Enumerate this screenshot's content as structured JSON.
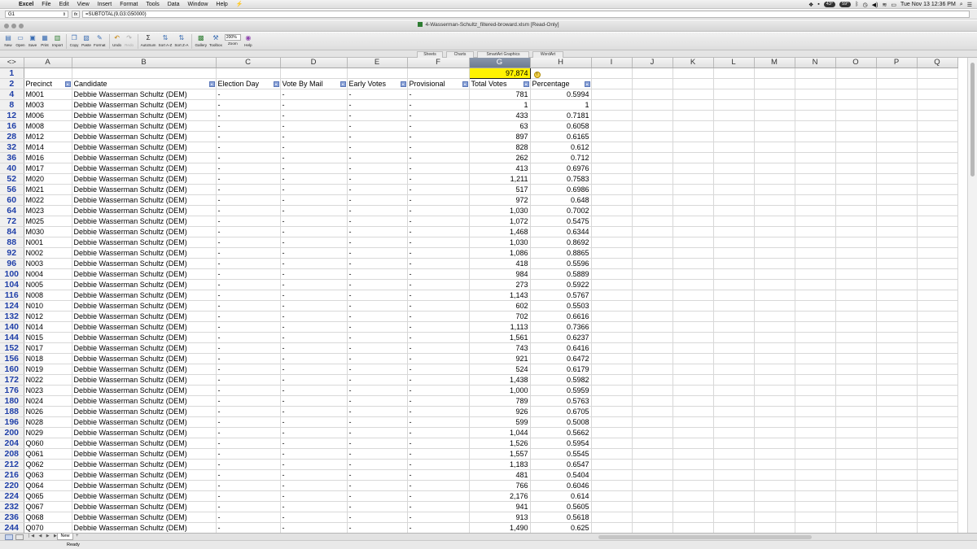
{
  "menubar": {
    "app": "Excel",
    "items": [
      "File",
      "Edit",
      "View",
      "Insert",
      "Format",
      "Tools",
      "Data",
      "Window",
      "Help"
    ],
    "clock": "Tue Nov 13  12:36 PM",
    "badges": [
      "43°",
      "59°"
    ]
  },
  "formula_bar": {
    "cell_ref": "G1",
    "fx": "fx",
    "formula": "=SUBTOTAL(9,G3:G50000)"
  },
  "window": {
    "title": "4-Wasserman-Schultz_filtered-broward.xlsm  [Read-Only]"
  },
  "toolbar": {
    "buttons": [
      {
        "label": "New",
        "icon": "new-document-icon"
      },
      {
        "label": "Open",
        "icon": "open-folder-icon"
      },
      {
        "label": "Save",
        "icon": "save-icon"
      },
      {
        "label": "Print",
        "icon": "print-icon"
      },
      {
        "label": "Import",
        "icon": "import-icon"
      },
      {
        "label": "Copy",
        "icon": "copy-icon"
      },
      {
        "label": "Paste",
        "icon": "paste-icon"
      },
      {
        "label": "Format",
        "icon": "format-brush-icon"
      },
      {
        "label": "Undo",
        "icon": "undo-icon"
      },
      {
        "label": "Redo",
        "icon": "redo-icon"
      },
      {
        "label": "AutoSum",
        "icon": "sigma-icon"
      },
      {
        "label": "Sort A-Z",
        "icon": "sort-az-icon"
      },
      {
        "label": "Sort Z-A",
        "icon": "sort-za-icon"
      },
      {
        "label": "Gallery",
        "icon": "gallery-icon"
      },
      {
        "label": "Toolbox",
        "icon": "toolbox-icon"
      },
      {
        "label": "Zoom",
        "icon": "zoom-icon"
      },
      {
        "label": "Help",
        "icon": "help-icon"
      }
    ],
    "zoom_value": "200%"
  },
  "ribbon_tabs": [
    "Sheets",
    "Charts",
    "SmartArt Graphics",
    "WordArt"
  ],
  "sheet": {
    "columns": [
      "A",
      "B",
      "C",
      "D",
      "E",
      "F",
      "G",
      "H",
      "I",
      "J",
      "K",
      "L",
      "M",
      "N",
      "O",
      "P",
      "Q"
    ],
    "selected_column": "G",
    "total_row_number": "1",
    "total_value": "97,874",
    "header_row_number": "2",
    "headers": [
      "Precinct",
      "Candidate",
      "Election Day",
      "Vote By Mail",
      "Early Votes",
      "Provisional",
      "Total Votes",
      "Percentage"
    ],
    "rows": [
      {
        "n": "4",
        "precinct": "M001",
        "candidate": "Debbie Wasserman Schultz (DEM)",
        "eday": "-",
        "vbm": "-",
        "early": "-",
        "prov": "-",
        "total": "781",
        "pct": "0.5994"
      },
      {
        "n": "8",
        "precinct": "M003",
        "candidate": "Debbie Wasserman Schultz (DEM)",
        "eday": "-",
        "vbm": "-",
        "early": "-",
        "prov": "-",
        "total": "1",
        "pct": "1"
      },
      {
        "n": "12",
        "precinct": "M006",
        "candidate": "Debbie Wasserman Schultz (DEM)",
        "eday": "-",
        "vbm": "-",
        "early": "-",
        "prov": "-",
        "total": "433",
        "pct": "0.7181"
      },
      {
        "n": "16",
        "precinct": "M008",
        "candidate": "Debbie Wasserman Schultz (DEM)",
        "eday": "-",
        "vbm": "-",
        "early": "-",
        "prov": "-",
        "total": "63",
        "pct": "0.6058"
      },
      {
        "n": "28",
        "precinct": "M012",
        "candidate": "Debbie Wasserman Schultz (DEM)",
        "eday": "-",
        "vbm": "-",
        "early": "-",
        "prov": "-",
        "total": "897",
        "pct": "0.6165"
      },
      {
        "n": "32",
        "precinct": "M014",
        "candidate": "Debbie Wasserman Schultz (DEM)",
        "eday": "-",
        "vbm": "-",
        "early": "-",
        "prov": "-",
        "total": "828",
        "pct": "0.612"
      },
      {
        "n": "36",
        "precinct": "M016",
        "candidate": "Debbie Wasserman Schultz (DEM)",
        "eday": "-",
        "vbm": "-",
        "early": "-",
        "prov": "-",
        "total": "262",
        "pct": "0.712"
      },
      {
        "n": "40",
        "precinct": "M017",
        "candidate": "Debbie Wasserman Schultz (DEM)",
        "eday": "-",
        "vbm": "-",
        "early": "-",
        "prov": "-",
        "total": "413",
        "pct": "0.6976"
      },
      {
        "n": "52",
        "precinct": "M020",
        "candidate": "Debbie Wasserman Schultz (DEM)",
        "eday": "-",
        "vbm": "-",
        "early": "-",
        "prov": "-",
        "total": "1,211",
        "pct": "0.7583"
      },
      {
        "n": "56",
        "precinct": "M021",
        "candidate": "Debbie Wasserman Schultz (DEM)",
        "eday": "-",
        "vbm": "-",
        "early": "-",
        "prov": "-",
        "total": "517",
        "pct": "0.6986"
      },
      {
        "n": "60",
        "precinct": "M022",
        "candidate": "Debbie Wasserman Schultz (DEM)",
        "eday": "-",
        "vbm": "-",
        "early": "-",
        "prov": "-",
        "total": "972",
        "pct": "0.648"
      },
      {
        "n": "64",
        "precinct": "M023",
        "candidate": "Debbie Wasserman Schultz (DEM)",
        "eday": "-",
        "vbm": "-",
        "early": "-",
        "prov": "-",
        "total": "1,030",
        "pct": "0.7002"
      },
      {
        "n": "72",
        "precinct": "M025",
        "candidate": "Debbie Wasserman Schultz (DEM)",
        "eday": "-",
        "vbm": "-",
        "early": "-",
        "prov": "-",
        "total": "1,072",
        "pct": "0.5475"
      },
      {
        "n": "84",
        "precinct": "M030",
        "candidate": "Debbie Wasserman Schultz (DEM)",
        "eday": "-",
        "vbm": "-",
        "early": "-",
        "prov": "-",
        "total": "1,468",
        "pct": "0.6344"
      },
      {
        "n": "88",
        "precinct": "N001",
        "candidate": "Debbie Wasserman Schultz (DEM)",
        "eday": "-",
        "vbm": "-",
        "early": "-",
        "prov": "-",
        "total": "1,030",
        "pct": "0.8692"
      },
      {
        "n": "92",
        "precinct": "N002",
        "candidate": "Debbie Wasserman Schultz (DEM)",
        "eday": "-",
        "vbm": "-",
        "early": "-",
        "prov": "-",
        "total": "1,086",
        "pct": "0.8865"
      },
      {
        "n": "96",
        "precinct": "N003",
        "candidate": "Debbie Wasserman Schultz (DEM)",
        "eday": "-",
        "vbm": "-",
        "early": "-",
        "prov": "-",
        "total": "418",
        "pct": "0.5596"
      },
      {
        "n": "100",
        "precinct": "N004",
        "candidate": "Debbie Wasserman Schultz (DEM)",
        "eday": "-",
        "vbm": "-",
        "early": "-",
        "prov": "-",
        "total": "984",
        "pct": "0.5889"
      },
      {
        "n": "104",
        "precinct": "N005",
        "candidate": "Debbie Wasserman Schultz (DEM)",
        "eday": "-",
        "vbm": "-",
        "early": "-",
        "prov": "-",
        "total": "273",
        "pct": "0.5922"
      },
      {
        "n": "116",
        "precinct": "N008",
        "candidate": "Debbie Wasserman Schultz (DEM)",
        "eday": "-",
        "vbm": "-",
        "early": "-",
        "prov": "-",
        "total": "1,143",
        "pct": "0.5767"
      },
      {
        "n": "124",
        "precinct": "N010",
        "candidate": "Debbie Wasserman Schultz (DEM)",
        "eday": "-",
        "vbm": "-",
        "early": "-",
        "prov": "-",
        "total": "602",
        "pct": "0.5503"
      },
      {
        "n": "132",
        "precinct": "N012",
        "candidate": "Debbie Wasserman Schultz (DEM)",
        "eday": "-",
        "vbm": "-",
        "early": "-",
        "prov": "-",
        "total": "702",
        "pct": "0.6616"
      },
      {
        "n": "140",
        "precinct": "N014",
        "candidate": "Debbie Wasserman Schultz (DEM)",
        "eday": "-",
        "vbm": "-",
        "early": "-",
        "prov": "-",
        "total": "1,113",
        "pct": "0.7366"
      },
      {
        "n": "144",
        "precinct": "N015",
        "candidate": "Debbie Wasserman Schultz (DEM)",
        "eday": "-",
        "vbm": "-",
        "early": "-",
        "prov": "-",
        "total": "1,561",
        "pct": "0.6237"
      },
      {
        "n": "152",
        "precinct": "N017",
        "candidate": "Debbie Wasserman Schultz (DEM)",
        "eday": "-",
        "vbm": "-",
        "early": "-",
        "prov": "-",
        "total": "743",
        "pct": "0.6416"
      },
      {
        "n": "156",
        "precinct": "N018",
        "candidate": "Debbie Wasserman Schultz (DEM)",
        "eday": "-",
        "vbm": "-",
        "early": "-",
        "prov": "-",
        "total": "921",
        "pct": "0.6472"
      },
      {
        "n": "160",
        "precinct": "N019",
        "candidate": "Debbie Wasserman Schultz (DEM)",
        "eday": "-",
        "vbm": "-",
        "early": "-",
        "prov": "-",
        "total": "524",
        "pct": "0.6179"
      },
      {
        "n": "172",
        "precinct": "N022",
        "candidate": "Debbie Wasserman Schultz (DEM)",
        "eday": "-",
        "vbm": "-",
        "early": "-",
        "prov": "-",
        "total": "1,438",
        "pct": "0.5982"
      },
      {
        "n": "176",
        "precinct": "N023",
        "candidate": "Debbie Wasserman Schultz (DEM)",
        "eday": "-",
        "vbm": "-",
        "early": "-",
        "prov": "-",
        "total": "1,000",
        "pct": "0.5959"
      },
      {
        "n": "180",
        "precinct": "N024",
        "candidate": "Debbie Wasserman Schultz (DEM)",
        "eday": "-",
        "vbm": "-",
        "early": "-",
        "prov": "-",
        "total": "789",
        "pct": "0.5763"
      },
      {
        "n": "188",
        "precinct": "N026",
        "candidate": "Debbie Wasserman Schultz (DEM)",
        "eday": "-",
        "vbm": "-",
        "early": "-",
        "prov": "-",
        "total": "926",
        "pct": "0.6705"
      },
      {
        "n": "196",
        "precinct": "N028",
        "candidate": "Debbie Wasserman Schultz (DEM)",
        "eday": "-",
        "vbm": "-",
        "early": "-",
        "prov": "-",
        "total": "599",
        "pct": "0.5008"
      },
      {
        "n": "200",
        "precinct": "N029",
        "candidate": "Debbie Wasserman Schultz (DEM)",
        "eday": "-",
        "vbm": "-",
        "early": "-",
        "prov": "-",
        "total": "1,044",
        "pct": "0.5662"
      },
      {
        "n": "204",
        "precinct": "Q060",
        "candidate": "Debbie Wasserman Schultz (DEM)",
        "eday": "-",
        "vbm": "-",
        "early": "-",
        "prov": "-",
        "total": "1,526",
        "pct": "0.5954"
      },
      {
        "n": "208",
        "precinct": "Q061",
        "candidate": "Debbie Wasserman Schultz (DEM)",
        "eday": "-",
        "vbm": "-",
        "early": "-",
        "prov": "-",
        "total": "1,557",
        "pct": "0.5545"
      },
      {
        "n": "212",
        "precinct": "Q062",
        "candidate": "Debbie Wasserman Schultz (DEM)",
        "eday": "-",
        "vbm": "-",
        "early": "-",
        "prov": "-",
        "total": "1,183",
        "pct": "0.6547"
      },
      {
        "n": "216",
        "precinct": "Q063",
        "candidate": "Debbie Wasserman Schultz (DEM)",
        "eday": "-",
        "vbm": "-",
        "early": "-",
        "prov": "-",
        "total": "481",
        "pct": "0.5404"
      },
      {
        "n": "220",
        "precinct": "Q064",
        "candidate": "Debbie Wasserman Schultz (DEM)",
        "eday": "-",
        "vbm": "-",
        "early": "-",
        "prov": "-",
        "total": "766",
        "pct": "0.6046"
      },
      {
        "n": "224",
        "precinct": "Q065",
        "candidate": "Debbie Wasserman Schultz (DEM)",
        "eday": "-",
        "vbm": "-",
        "early": "-",
        "prov": "-",
        "total": "2,176",
        "pct": "0.614"
      },
      {
        "n": "232",
        "precinct": "Q067",
        "candidate": "Debbie Wasserman Schultz (DEM)",
        "eday": "-",
        "vbm": "-",
        "early": "-",
        "prov": "-",
        "total": "941",
        "pct": "0.5605"
      },
      {
        "n": "236",
        "precinct": "Q068",
        "candidate": "Debbie Wasserman Schultz (DEM)",
        "eday": "-",
        "vbm": "-",
        "early": "-",
        "prov": "-",
        "total": "913",
        "pct": "0.5618"
      },
      {
        "n": "244",
        "precinct": "Q070",
        "candidate": "Debbie Wasserman Schultz (DEM)",
        "eday": "-",
        "vbm": "-",
        "early": "-",
        "prov": "-",
        "total": "1,490",
        "pct": "0.625"
      }
    ]
  },
  "sheet_tabs": {
    "active": "New"
  },
  "status": {
    "text": "Ready"
  },
  "colors": {
    "selected_cell_fill": "#fff200",
    "row_header_text": "#1f3fa8",
    "selected_column_header": "#7a879c"
  }
}
